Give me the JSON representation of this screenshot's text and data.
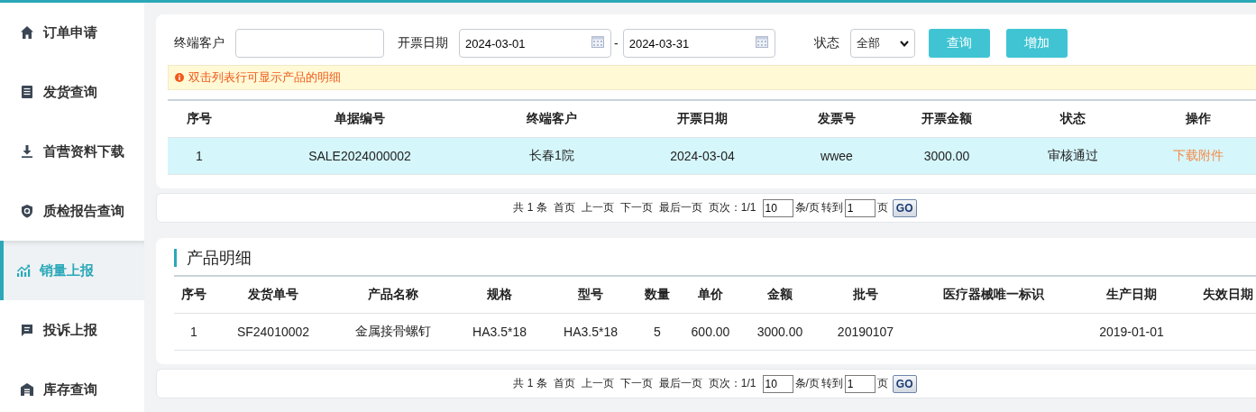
{
  "sidebar": {
    "items": [
      {
        "label": "订单申请",
        "selected": false
      },
      {
        "label": "发货查询",
        "selected": false
      },
      {
        "label": "首营资料下载",
        "selected": false
      },
      {
        "label": "质检报告查询",
        "selected": false
      },
      {
        "label": "销量上报",
        "selected": true
      },
      {
        "label": "投诉上报",
        "selected": false
      },
      {
        "label": "库存查询",
        "selected": false
      }
    ]
  },
  "filters": {
    "customer": {
      "label": "终端客户"
    },
    "date": {
      "label": "开票日期",
      "from": "2024-03-01",
      "separator": "-",
      "to": "2024-03-31"
    },
    "status": {
      "label": "状态",
      "value": "全部"
    },
    "buttons": [
      "查询",
      "增加"
    ]
  },
  "notice": "双击列表行可显示产品的明细",
  "orders": {
    "columns": [
      "序号",
      "单据编号",
      "终端客户",
      "开票日期",
      "发票号",
      "开票金额",
      "状态",
      "操作"
    ],
    "rows": [
      {
        "selected": true,
        "cells": [
          "1",
          "SALE2024000002",
          "长春1院",
          "2024-03-04",
          "wwee",
          "3000.00",
          "审核通过"
        ],
        "action": "下载附件"
      }
    ]
  },
  "orders_pager": {
    "total": "共 1 条",
    "links": [
      "首页",
      "上一页",
      "下一页",
      "最后一页"
    ],
    "page_info": "页次：1/1",
    "page_size": "10",
    "per_page_label": "条/页",
    "goto_label": "转到",
    "goto_value": "1",
    "page_suffix": "页",
    "go_button": "GO"
  },
  "details": {
    "title": "产品明细",
    "columns": [
      "序号",
      "发货单号",
      "产品名称",
      "规格",
      "型号",
      "数量",
      "单价",
      "金额",
      "批号",
      "医疗器械唯一标识",
      "生产日期",
      "失效日期"
    ],
    "rows": [
      {
        "selected": false,
        "cells": [
          "1",
          "SF24010002",
          "金属接骨螺钉",
          "HA3.5*18",
          "HA3.5*18",
          "5",
          "600.00",
          "3000.00",
          "20190107",
          null,
          "2019-01-01",
          null
        ]
      }
    ]
  },
  "details_pager": {
    "total": "共 1 条",
    "links": [
      "首页",
      "上一页",
      "下一页",
      "最后一页"
    ],
    "page_info": "页次：1/1",
    "page_size": "10",
    "per_page_label": "条/页",
    "goto_label": "转到",
    "goto_value": "1",
    "page_suffix": "页",
    "go_button": "GO"
  }
}
